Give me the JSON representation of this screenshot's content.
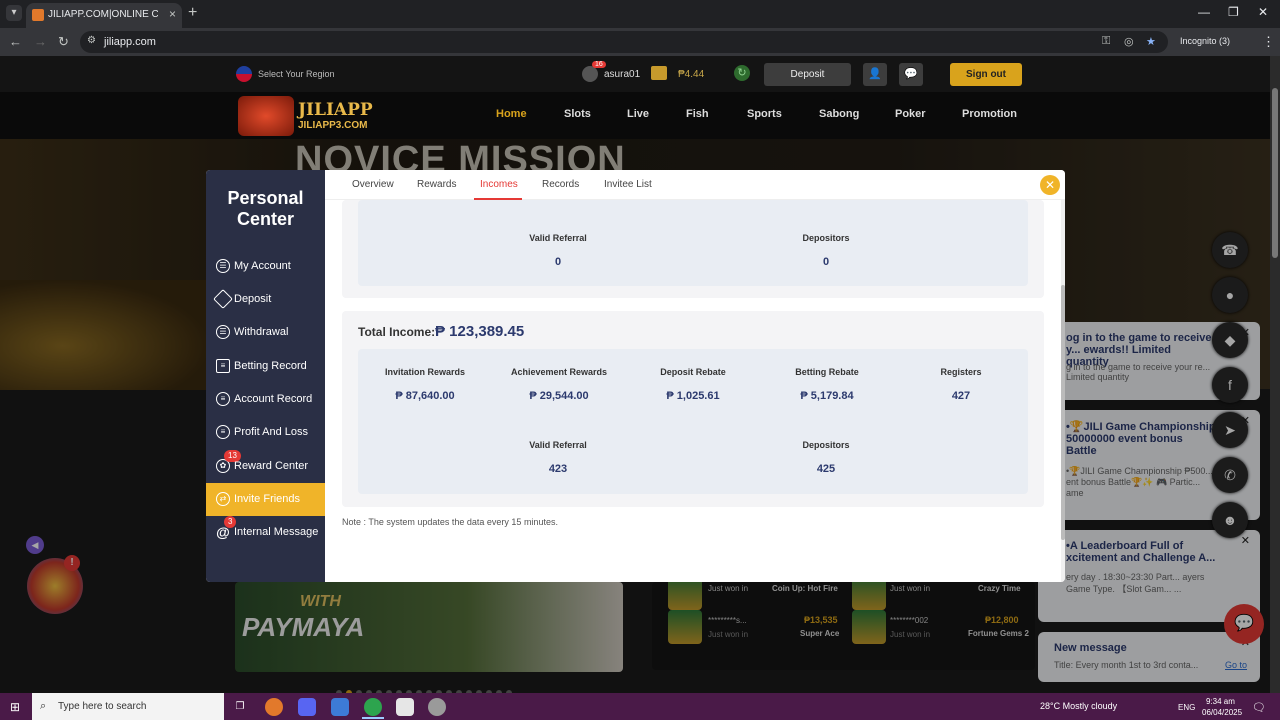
{
  "browser": {
    "tab_title": "JILIAPP.COM|ONLINE CASINO|",
    "tab_close": "×",
    "new_tab": "+",
    "url": "jiliapp.com",
    "incognito": "Incognito (3)",
    "minimize": "—",
    "maximize": "❐",
    "close": "✕"
  },
  "site": {
    "region": "Select Your Region",
    "user_badge": "16",
    "username": "asura01",
    "balance": "₱4.44",
    "deposit": "Deposit",
    "signout": "Sign out",
    "logo_main": "JILIAPP",
    "logo_sub": "JILIAPP3.COM",
    "nav": [
      "Home",
      "Slots",
      "Live",
      "Fish",
      "Sports",
      "Sabong",
      "Poker",
      "Promotion"
    ],
    "banner_title": "NOVICE MISSION",
    "paymaya_with": "WITH",
    "paymaya": "PAYMAYA"
  },
  "winners": [
    {
      "user": "Just won in",
      "sub": "",
      "amount": "",
      "game": "Coin Up: Hot Fire"
    },
    {
      "user": "Just won in",
      "sub": "",
      "amount": "",
      "game": "Crazy Time"
    },
    {
      "user": "*********s...",
      "sub": "Just won in",
      "amount": "₱13,535",
      "game": "Super Ace"
    },
    {
      "user": "********002",
      "sub": "Just won in",
      "amount": "₱12,800",
      "game": "Fortune Gems 2"
    }
  ],
  "notifications": [
    {
      "title": "og in to the game to receive y... ewards!! Limited quantity",
      "body": "g in to the game to receive your re... Limited quantity"
    },
    {
      "title": "•🏆JILI Game Championship 50000000 event bonus Battle",
      "body": "•🏆JILI Game Championship ₱500... ent bonus Battle🏆✨ 🎮 Partic... ame"
    },
    {
      "title": "•A Leaderboard Full of xcitement and Challenge A...",
      "body": "ery day . 18:30~23:30 Part... ayers Game Type. 【Slot Gam... ..."
    },
    {
      "title": "New message",
      "body": "Title: Every month 1st to 3rd conta...",
      "link": "Go to"
    }
  ],
  "modal": {
    "side_title": "Personal Center",
    "side_items": [
      {
        "label": "My Account",
        "icon": "user-icon",
        "badge": ""
      },
      {
        "label": "Deposit",
        "icon": "deposit-icon",
        "badge": ""
      },
      {
        "label": "Withdrawal",
        "icon": "withdrawal-icon",
        "badge": ""
      },
      {
        "label": "Betting Record",
        "icon": "betting-record-icon",
        "badge": ""
      },
      {
        "label": "Account Record",
        "icon": "account-record-icon",
        "badge": ""
      },
      {
        "label": "Profit And Loss",
        "icon": "profit-icon",
        "badge": ""
      },
      {
        "label": "Reward Center",
        "icon": "gift-icon",
        "badge": "13"
      },
      {
        "label": "Invite Friends",
        "icon": "invite-icon",
        "badge": ""
      },
      {
        "label": "Internal Message",
        "icon": "at-icon",
        "badge": "3"
      }
    ],
    "tabs": [
      "Overview",
      "Rewards",
      "Incomes",
      "Records",
      "Invitee List"
    ],
    "active_tab": "Incomes",
    "top_card": {
      "valid_referral_label": "Valid Referral",
      "valid_referral_value": "0",
      "depositors_label": "Depositors",
      "depositors_value": "0"
    },
    "total_income_label": "Total Income:",
    "total_income_value": "₱ 123,389.45",
    "stats": [
      {
        "label": "Invitation Rewards",
        "value": "₱ 87,640.00"
      },
      {
        "label": "Achievement Rewards",
        "value": "₱ 29,544.00"
      },
      {
        "label": "Deposit Rebate",
        "value": "₱ 1,025.61"
      },
      {
        "label": "Betting Rebate",
        "value": "₱ 5,179.84"
      },
      {
        "label": "Registers",
        "value": "427"
      }
    ],
    "valid_referral_label": "Valid Referral",
    "valid_referral_value": "423",
    "depositors_label": "Depositors",
    "depositors_value": "425",
    "note": "Note : The system updates the data every 15 minutes.",
    "close": "✕"
  },
  "taskbar": {
    "search_placeholder": "Type here to search",
    "weather": "28°C  Mostly cloudy",
    "lang": "ENG",
    "time": "9:34 am",
    "date": "06/04/2025"
  },
  "colors": {
    "accent": "#f0b429",
    "nav_active": "#d9a31c",
    "tab_active": "#e53935",
    "sidebar_bg": "#2a2f45",
    "value_text": "#2c3a6e"
  }
}
